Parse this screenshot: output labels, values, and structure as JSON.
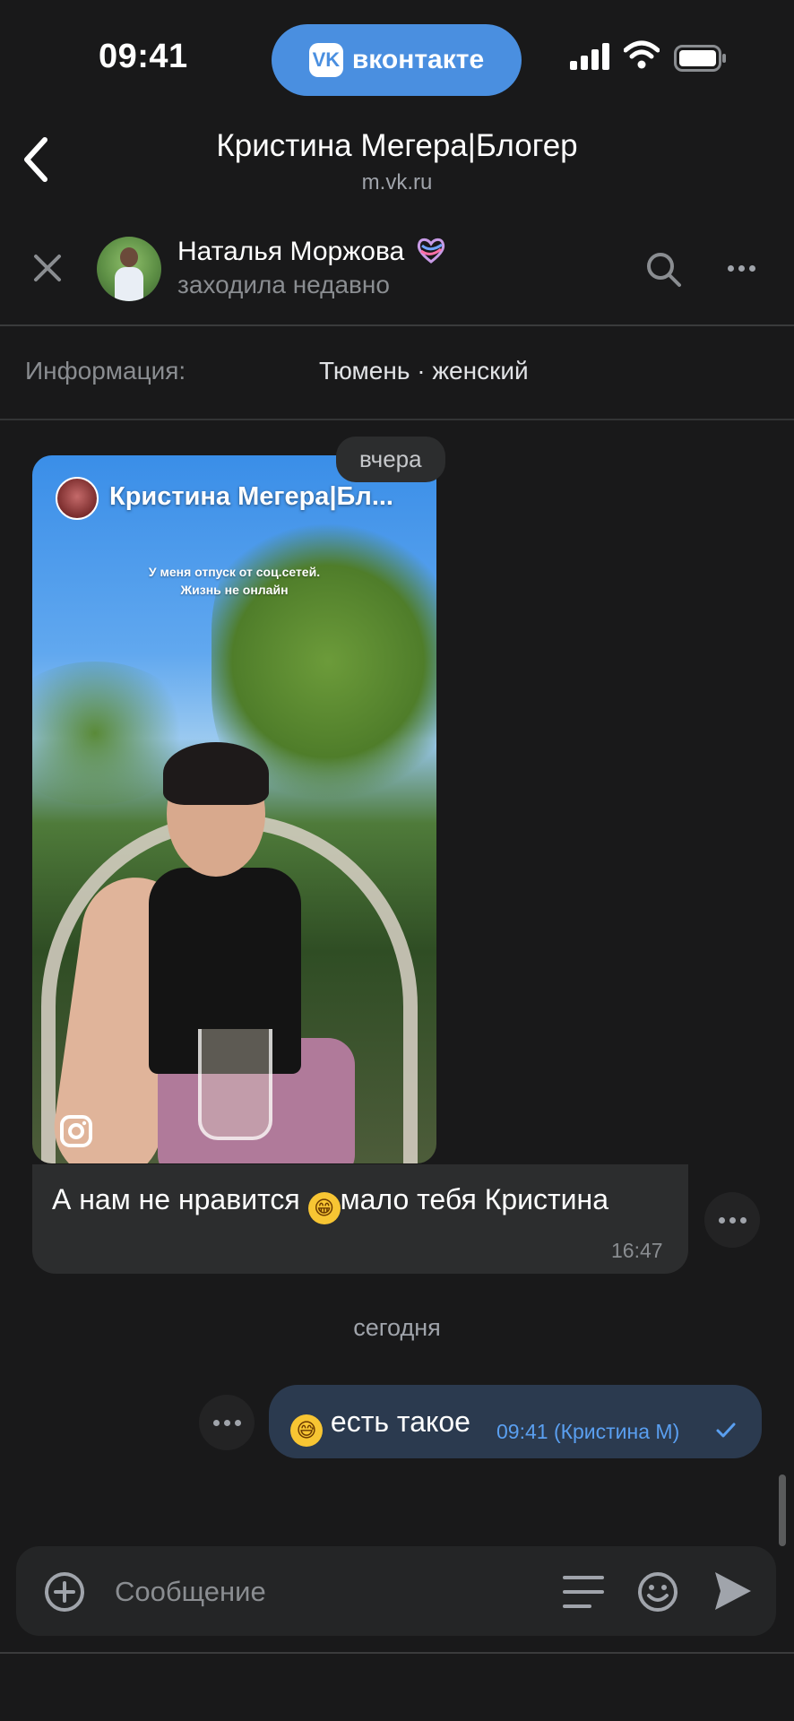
{
  "status_bar": {
    "time": "09:41",
    "app_pill": {
      "logo_text": "VK",
      "label": "вконтакте"
    }
  },
  "header": {
    "title": "Кристина Мегера|Блогер",
    "subtitle": "m.vk.ru"
  },
  "contact": {
    "name": "Наталья Моржова",
    "status": "заходила недавно"
  },
  "info": {
    "label": "Информация:",
    "value": "Тюмень · женский"
  },
  "messages": {
    "date_yesterday": "вчера",
    "story": {
      "author": "Кристина Мегера|Бл...",
      "caption_line1": "У меня отпуск от соц.сетей.",
      "caption_line2": "Жизнь не онлайн"
    },
    "incoming": {
      "text_before": "А нам не нравится ",
      "emoji": "😁",
      "text_after": "мало тебя Кристина",
      "time": "16:47"
    },
    "date_today": "сегодня",
    "outgoing": {
      "emoji": "😅",
      "text": " есть такое",
      "time": "09:41 (Кристина М)"
    }
  },
  "composer": {
    "placeholder": "Сообщение"
  },
  "colors": {
    "accent": "#4a8fe0",
    "background": "#19191a",
    "bubble_in": "#2c2d2e",
    "bubble_out": "#2b3a4f",
    "time_out": "#5a9ff0"
  },
  "icons": [
    "back-chevron-icon",
    "close-icon",
    "search-icon",
    "more-icon",
    "instagram-icon",
    "plus-icon",
    "menu-icon",
    "smile-icon",
    "send-icon",
    "check-icon",
    "signal-icon",
    "wifi-icon",
    "battery-icon"
  ]
}
